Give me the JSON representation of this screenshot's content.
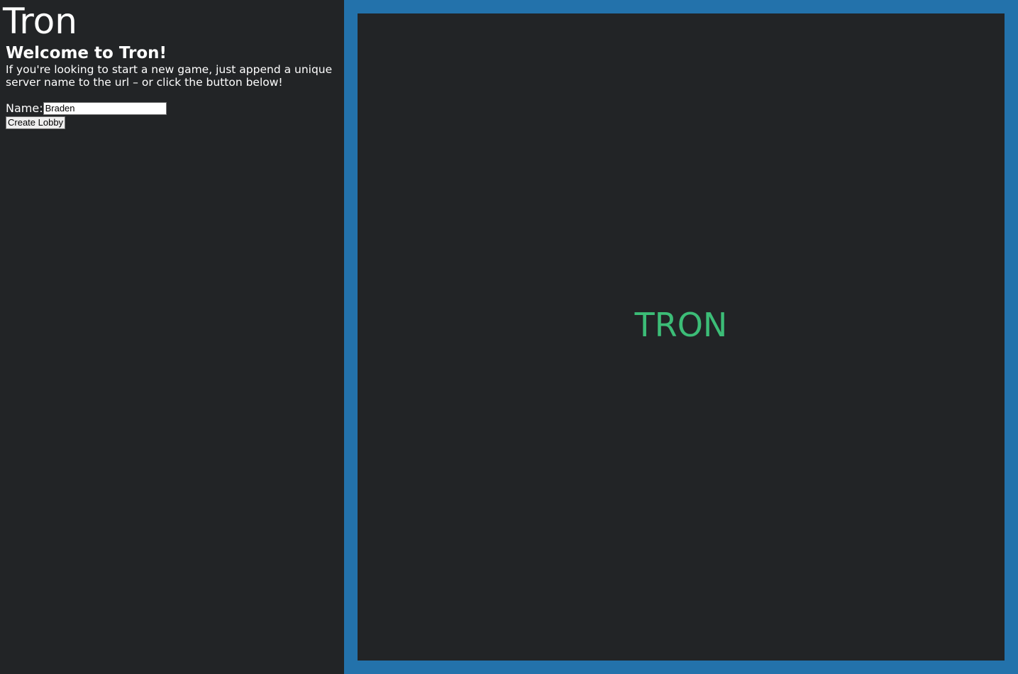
{
  "app": {
    "title": "Tron"
  },
  "sidebar": {
    "welcome_heading": "Welcome to Tron!",
    "intro_text": "If you're looking to start a new game, just append a unique server name to the url – or click the button below!",
    "name_label": "Name:",
    "name_value": "Braden",
    "create_button_label": "Create Lobby"
  },
  "game": {
    "splash_title": "TRON",
    "splash_color": "#3cbd77",
    "frame_color": "#2372ab",
    "background_color": "#222426"
  }
}
